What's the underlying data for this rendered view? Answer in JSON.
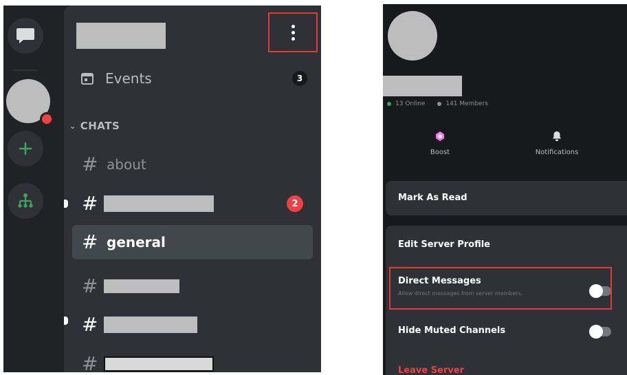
{
  "left": {
    "events": {
      "label": "Events",
      "count": "3"
    },
    "category": {
      "label": "CHATS"
    },
    "channels": [
      {
        "name": "about"
      },
      {
        "name": "",
        "mentions": "2"
      },
      {
        "name": "general"
      },
      {
        "name": ""
      },
      {
        "name": ""
      },
      {
        "name": ""
      }
    ]
  },
  "right": {
    "stats": {
      "online": "13 Online",
      "members": "141 Members"
    },
    "actions": {
      "boost": "Boost",
      "notifications": "Notifications"
    },
    "mark_as_read": "Mark As Read",
    "edit_server_profile": "Edit Server Profile",
    "direct_messages": {
      "label": "Direct Messages",
      "description": "Allow direct messages from server members."
    },
    "hide_muted": "Hide Muted Channels",
    "leave": "Leave Server"
  },
  "colors": {
    "accent_red": "#e03c3c",
    "online_green": "#3ba55c",
    "boost_pink": "#ff73fa",
    "danger": "#ed4245"
  }
}
